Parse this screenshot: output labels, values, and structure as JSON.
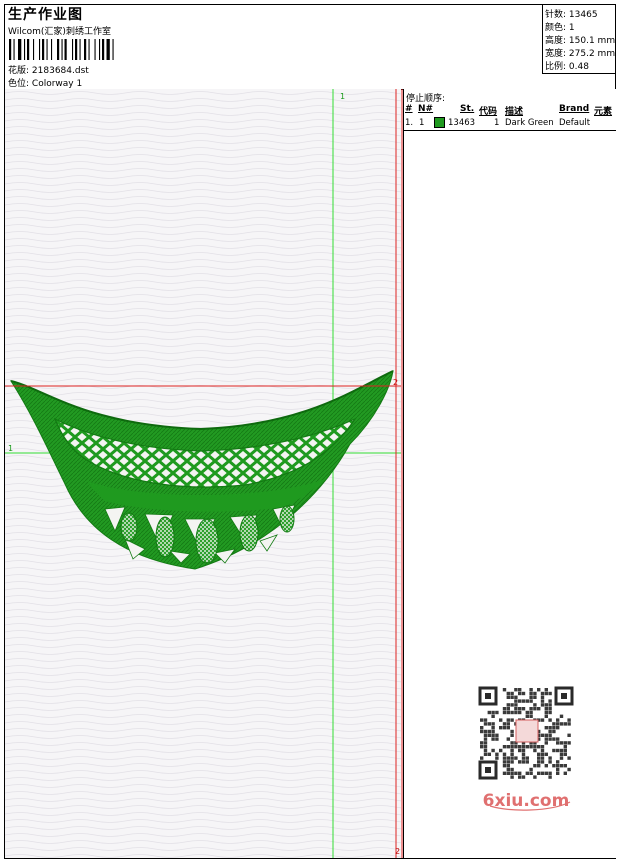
{
  "header": {
    "title": "生产作业图",
    "studio": "Wilcom(汇家)刺绣工作室",
    "design_label": "花版:",
    "design_value": "2183684.dst",
    "colorway_label": "色位:",
    "colorway_value": "Colorway 1"
  },
  "stats": {
    "stitches_label": "针数:",
    "stitches_value": "13465",
    "colors_label": "颜色:",
    "colors_value": "1",
    "height_label": "高度:",
    "height_value": "150.1 mm",
    "width_label": "宽度:",
    "width_value": "275.2 mm",
    "scale_label": "比例:",
    "scale_value": "0.48"
  },
  "stop_sequence": {
    "label": "停止顺序:",
    "headers": [
      "#",
      "N#",
      "St.",
      "代码",
      "描述",
      "Brand",
      "元素"
    ],
    "rows": [
      {
        "num": "1.",
        "needle": "1",
        "color": "#1f9a1f",
        "stitches": "13463",
        "code": "1",
        "description": "Dark Green",
        "brand": "Default"
      }
    ]
  },
  "guides": {
    "top_green": "1",
    "left_green": "1",
    "right_red": "2",
    "bottom_red": "2"
  },
  "watermark": {
    "text": "6xiu.com"
  }
}
